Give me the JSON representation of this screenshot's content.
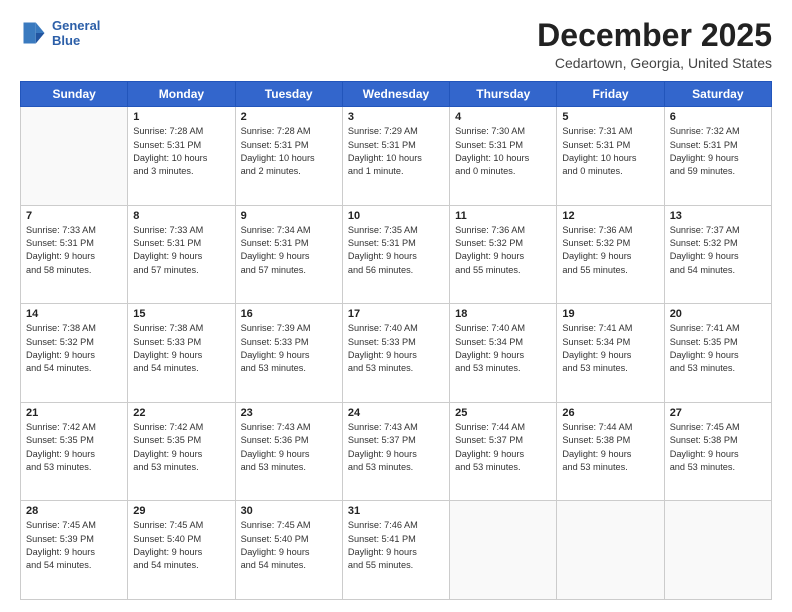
{
  "logo": {
    "line1": "General",
    "line2": "Blue"
  },
  "title": "December 2025",
  "subtitle": "Cedartown, Georgia, United States",
  "days_of_week": [
    "Sunday",
    "Monday",
    "Tuesday",
    "Wednesday",
    "Thursday",
    "Friday",
    "Saturday"
  ],
  "weeks": [
    [
      {
        "day": "",
        "info": ""
      },
      {
        "day": "1",
        "info": "Sunrise: 7:28 AM\nSunset: 5:31 PM\nDaylight: 10 hours\nand 3 minutes."
      },
      {
        "day": "2",
        "info": "Sunrise: 7:28 AM\nSunset: 5:31 PM\nDaylight: 10 hours\nand 2 minutes."
      },
      {
        "day": "3",
        "info": "Sunrise: 7:29 AM\nSunset: 5:31 PM\nDaylight: 10 hours\nand 1 minute."
      },
      {
        "day": "4",
        "info": "Sunrise: 7:30 AM\nSunset: 5:31 PM\nDaylight: 10 hours\nand 0 minutes."
      },
      {
        "day": "5",
        "info": "Sunrise: 7:31 AM\nSunset: 5:31 PM\nDaylight: 10 hours\nand 0 minutes."
      },
      {
        "day": "6",
        "info": "Sunrise: 7:32 AM\nSunset: 5:31 PM\nDaylight: 9 hours\nand 59 minutes."
      }
    ],
    [
      {
        "day": "7",
        "info": "Sunrise: 7:33 AM\nSunset: 5:31 PM\nDaylight: 9 hours\nand 58 minutes."
      },
      {
        "day": "8",
        "info": "Sunrise: 7:33 AM\nSunset: 5:31 PM\nDaylight: 9 hours\nand 57 minutes."
      },
      {
        "day": "9",
        "info": "Sunrise: 7:34 AM\nSunset: 5:31 PM\nDaylight: 9 hours\nand 57 minutes."
      },
      {
        "day": "10",
        "info": "Sunrise: 7:35 AM\nSunset: 5:31 PM\nDaylight: 9 hours\nand 56 minutes."
      },
      {
        "day": "11",
        "info": "Sunrise: 7:36 AM\nSunset: 5:32 PM\nDaylight: 9 hours\nand 55 minutes."
      },
      {
        "day": "12",
        "info": "Sunrise: 7:36 AM\nSunset: 5:32 PM\nDaylight: 9 hours\nand 55 minutes."
      },
      {
        "day": "13",
        "info": "Sunrise: 7:37 AM\nSunset: 5:32 PM\nDaylight: 9 hours\nand 54 minutes."
      }
    ],
    [
      {
        "day": "14",
        "info": "Sunrise: 7:38 AM\nSunset: 5:32 PM\nDaylight: 9 hours\nand 54 minutes."
      },
      {
        "day": "15",
        "info": "Sunrise: 7:38 AM\nSunset: 5:33 PM\nDaylight: 9 hours\nand 54 minutes."
      },
      {
        "day": "16",
        "info": "Sunrise: 7:39 AM\nSunset: 5:33 PM\nDaylight: 9 hours\nand 53 minutes."
      },
      {
        "day": "17",
        "info": "Sunrise: 7:40 AM\nSunset: 5:33 PM\nDaylight: 9 hours\nand 53 minutes."
      },
      {
        "day": "18",
        "info": "Sunrise: 7:40 AM\nSunset: 5:34 PM\nDaylight: 9 hours\nand 53 minutes."
      },
      {
        "day": "19",
        "info": "Sunrise: 7:41 AM\nSunset: 5:34 PM\nDaylight: 9 hours\nand 53 minutes."
      },
      {
        "day": "20",
        "info": "Sunrise: 7:41 AM\nSunset: 5:35 PM\nDaylight: 9 hours\nand 53 minutes."
      }
    ],
    [
      {
        "day": "21",
        "info": "Sunrise: 7:42 AM\nSunset: 5:35 PM\nDaylight: 9 hours\nand 53 minutes."
      },
      {
        "day": "22",
        "info": "Sunrise: 7:42 AM\nSunset: 5:35 PM\nDaylight: 9 hours\nand 53 minutes."
      },
      {
        "day": "23",
        "info": "Sunrise: 7:43 AM\nSunset: 5:36 PM\nDaylight: 9 hours\nand 53 minutes."
      },
      {
        "day": "24",
        "info": "Sunrise: 7:43 AM\nSunset: 5:37 PM\nDaylight: 9 hours\nand 53 minutes."
      },
      {
        "day": "25",
        "info": "Sunrise: 7:44 AM\nSunset: 5:37 PM\nDaylight: 9 hours\nand 53 minutes."
      },
      {
        "day": "26",
        "info": "Sunrise: 7:44 AM\nSunset: 5:38 PM\nDaylight: 9 hours\nand 53 minutes."
      },
      {
        "day": "27",
        "info": "Sunrise: 7:45 AM\nSunset: 5:38 PM\nDaylight: 9 hours\nand 53 minutes."
      }
    ],
    [
      {
        "day": "28",
        "info": "Sunrise: 7:45 AM\nSunset: 5:39 PM\nDaylight: 9 hours\nand 54 minutes."
      },
      {
        "day": "29",
        "info": "Sunrise: 7:45 AM\nSunset: 5:40 PM\nDaylight: 9 hours\nand 54 minutes."
      },
      {
        "day": "30",
        "info": "Sunrise: 7:45 AM\nSunset: 5:40 PM\nDaylight: 9 hours\nand 54 minutes."
      },
      {
        "day": "31",
        "info": "Sunrise: 7:46 AM\nSunset: 5:41 PM\nDaylight: 9 hours\nand 55 minutes."
      },
      {
        "day": "",
        "info": ""
      },
      {
        "day": "",
        "info": ""
      },
      {
        "day": "",
        "info": ""
      }
    ]
  ]
}
